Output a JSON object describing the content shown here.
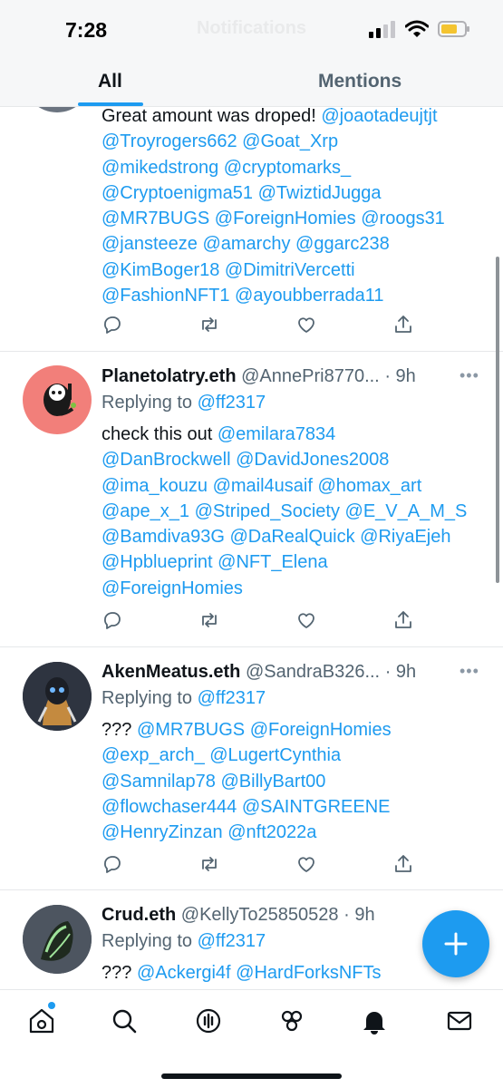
{
  "status": {
    "time": "7:28",
    "ghost_title": "Notifications"
  },
  "tabs": [
    {
      "label": "All",
      "active": true
    },
    {
      "label": "Mentions",
      "active": false
    }
  ],
  "tweets": [
    {
      "name": "",
      "handle": "",
      "time": "",
      "replying_label": "",
      "replying_to": "",
      "lines": [
        {
          "text": "Great amount was droped! ",
          "mentions": "@joaotadeujtjt"
        },
        {
          "text": "",
          "mentions": "@Troyrogers662 @Goat_Xrp"
        },
        {
          "text": "",
          "mentions": "@mikedstrong @cryptomarks_"
        },
        {
          "text": "",
          "mentions": "@Cryptoenigma51 @TwiztidJugga"
        },
        {
          "text": "",
          "mentions": "@MR7BUGS @ForeignHomies @roogs31"
        },
        {
          "text": "",
          "mentions": "@jansteeze @amarchy @ggarc238"
        },
        {
          "text": "",
          "mentions": "@KimBoger18 @DimitriVercetti"
        },
        {
          "text": "",
          "mentions": "@FashionNFT1 @ayoubberrada11"
        }
      ]
    },
    {
      "name": "Planetolatry.eth",
      "handle": "@AnnePri8770...",
      "time": "· 9h",
      "replying_label": "Replying to",
      "replying_to": "@ff2317",
      "lines": [
        {
          "text": "check this out ",
          "mentions": "@emilara7834"
        },
        {
          "text": "",
          "mentions": "@DanBrockwell @DavidJones2008"
        },
        {
          "text": "",
          "mentions": "@ima_kouzu @mail4usaif @homax_art"
        },
        {
          "text": "",
          "mentions": "@ape_x_1 @Striped_Society @E_V_A_M_S"
        },
        {
          "text": "",
          "mentions": "@Bamdiva93G @DaRealQuick @RiyaEjeh"
        },
        {
          "text": "",
          "mentions": "@Hpblueprint @NFT_Elena"
        },
        {
          "text": "",
          "mentions": "@ForeignHomies"
        }
      ]
    },
    {
      "name": "AkenMeatus.eth",
      "handle": "@SandraB326...",
      "time": "· 9h",
      "replying_label": "Replying to",
      "replying_to": "@ff2317",
      "lines": [
        {
          "text": "??? ",
          "mentions": "@MR7BUGS @ForeignHomies"
        },
        {
          "text": "",
          "mentions": "@exp_arch_ @LugertCynthia"
        },
        {
          "text": "",
          "mentions": "@Samnilap78 @BillyBart00"
        },
        {
          "text": "",
          "mentions": "@flowchaser444 @SAINTGREENE"
        },
        {
          "text": "",
          "mentions": "@HenryZinzan @nft2022a"
        }
      ]
    },
    {
      "name": "Crud.eth",
      "handle": "@KellyTo25850528",
      "time": "· 9h",
      "replying_label": "Replying to",
      "replying_to": "@ff2317",
      "lines": [
        {
          "text": "??? ",
          "mentions": "@Ackergi4f @HardForksNFTs"
        }
      ]
    }
  ],
  "bottom_nav": [
    {
      "name": "home-icon",
      "has_dot": true,
      "color": "#0f1419"
    },
    {
      "name": "search-icon",
      "has_dot": false,
      "color": "#0f1419"
    },
    {
      "name": "spaces-icon",
      "has_dot": false,
      "color": "#0f1419"
    },
    {
      "name": "communities-icon",
      "has_dot": false,
      "color": "#0f1419"
    },
    {
      "name": "notifications-bell-icon",
      "has_dot": false,
      "color": "#0f1419"
    },
    {
      "name": "messages-icon",
      "has_dot": false,
      "color": "#0f1419"
    }
  ],
  "fab": {
    "icon": "compose-plus-icon",
    "color": "#1d9bf0"
  },
  "colors": {
    "accent": "#1d9bf0",
    "text": "#0f1419",
    "muted": "#536471"
  }
}
